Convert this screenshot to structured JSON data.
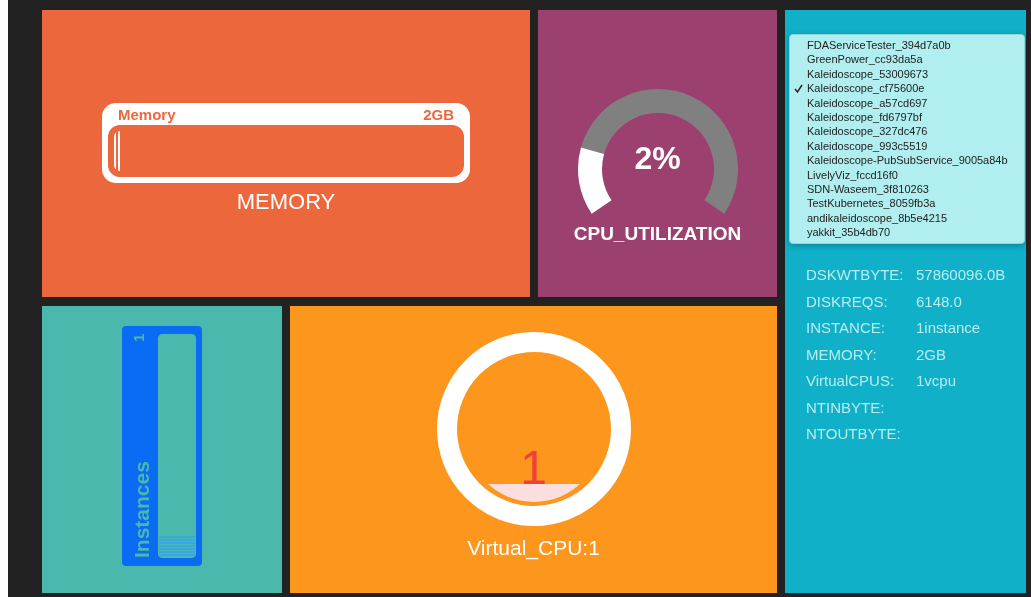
{
  "memory_tile": {
    "label": "Memory",
    "capacity": "2GB",
    "level": 0.02,
    "title": "MEMORY"
  },
  "cpu_tile": {
    "reading": "2%",
    "level": 0.2,
    "title": "CPU_UTILIZATION"
  },
  "instances_tile": {
    "label": "Instances",
    "count": "1",
    "level": 0.1
  },
  "vcpu_tile": {
    "reading": "1",
    "level": 0.12,
    "title": "Virtual_CPU:1"
  },
  "service_menu": {
    "items": [
      {
        "label": "FDAServiceTester_394d7a0b",
        "selected": false
      },
      {
        "label": "GreenPower_cc93da5a",
        "selected": false
      },
      {
        "label": "Kaleidoscope_53009673",
        "selected": false
      },
      {
        "label": "Kaleidoscope_cf75600e",
        "selected": true
      },
      {
        "label": "Kaleidoscope_a57cd697",
        "selected": false
      },
      {
        "label": "Kaleidoscope_fd6797bf",
        "selected": false
      },
      {
        "label": "Kaleidoscope_327dc476",
        "selected": false
      },
      {
        "label": "Kaleidoscope_993c5519",
        "selected": false
      },
      {
        "label": "Kaleidoscope-PubSubService_9005a84b",
        "selected": false
      },
      {
        "label": "LivelyViz_fccd16f0",
        "selected": false
      },
      {
        "label": "SDN-Waseem_3f810263",
        "selected": false
      },
      {
        "label": "TestKubernetes_8059fb3a",
        "selected": false
      },
      {
        "label": "andikaleidoscope_8b5e4215",
        "selected": false
      },
      {
        "label": "yakkit_35b4db70",
        "selected": false
      }
    ]
  },
  "details": [
    {
      "key": "DSKWTBYTE:",
      "value": "57860096.0B"
    },
    {
      "key": "DISKREQS:",
      "value": "6148.0"
    },
    {
      "key": "INSTANCE:",
      "value": "1instance"
    },
    {
      "key": "MEMORY:",
      "value": "2GB"
    },
    {
      "key": "VirtualCPUS:",
      "value": "1vcpu"
    },
    {
      "key": "NTINBYTE:"
    },
    {
      "key": "NTOUTBYTE:"
    }
  ]
}
